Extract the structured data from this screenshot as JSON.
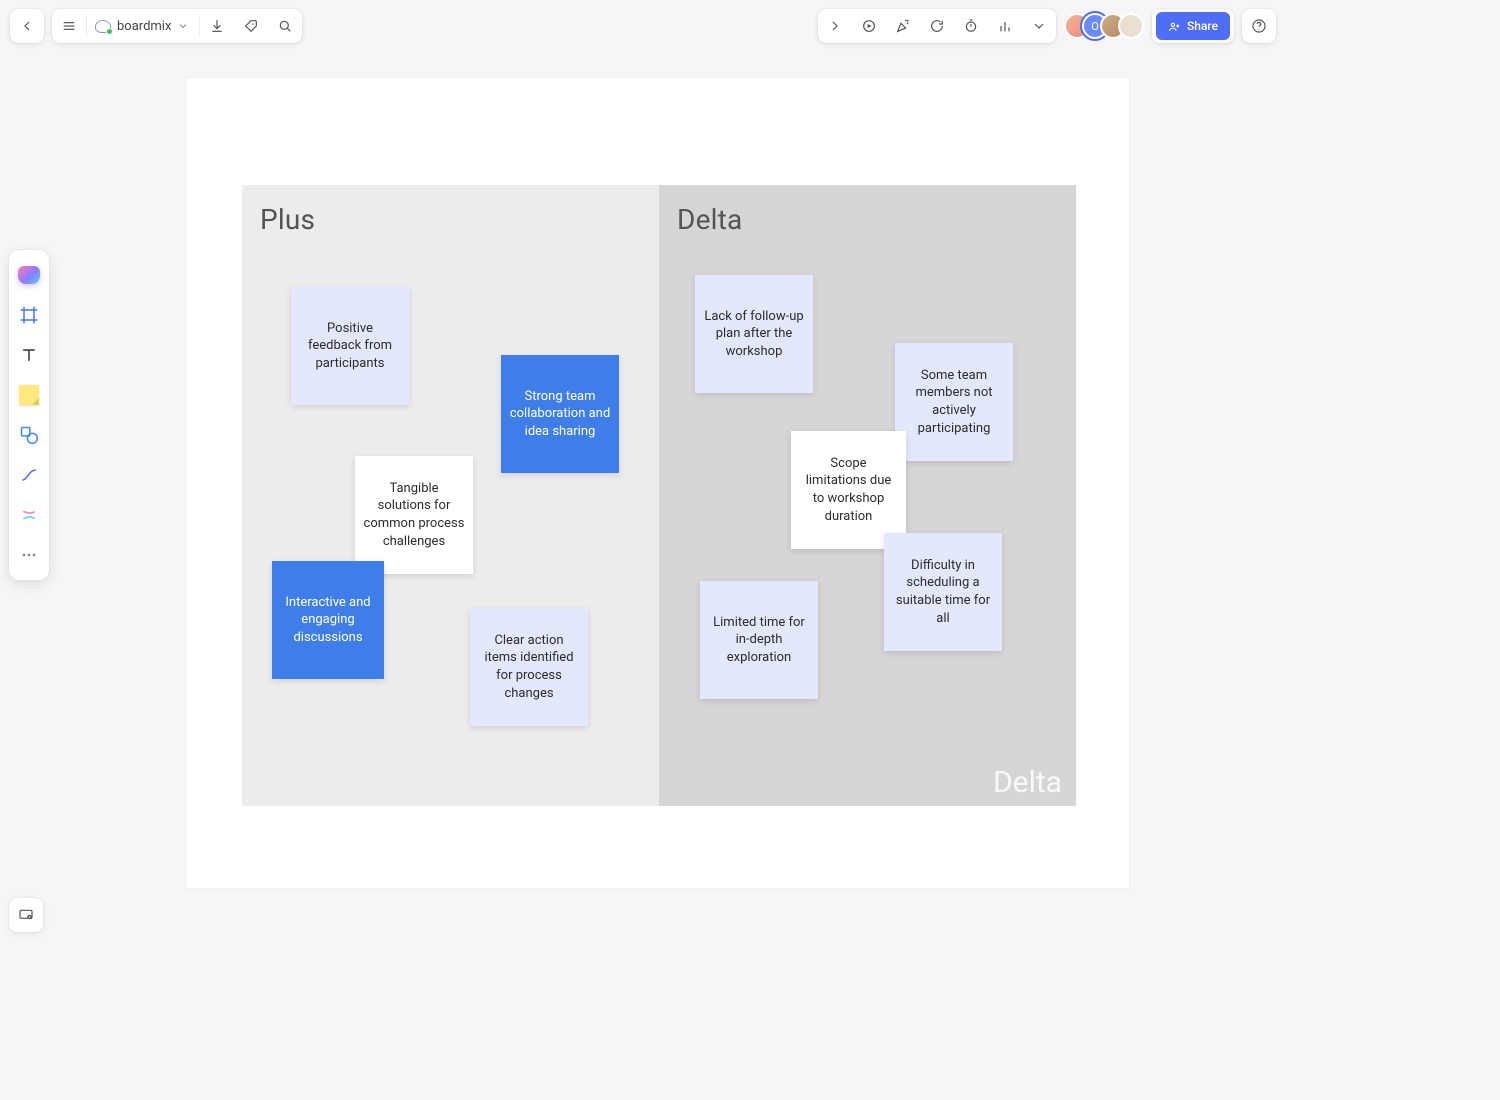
{
  "app": {
    "title": "boardmix",
    "share_label": "Share"
  },
  "board": {
    "columns": {
      "plus": {
        "title": "Plus"
      },
      "delta": {
        "title": "Delta",
        "watermark": "Delta"
      }
    },
    "plus_notes": [
      {
        "text": "Positive feedback from participants"
      },
      {
        "text": "Strong team collaboration and idea sharing"
      },
      {
        "text": "Tangible solutions for common process challenges"
      },
      {
        "text": "Interactive and engaging discussions"
      },
      {
        "text": "Clear action items identified for process changes"
      }
    ],
    "delta_notes": [
      {
        "text": "Lack of follow-up plan after the workshop"
      },
      {
        "text": "Some team members not actively participating"
      },
      {
        "text": "Scope limitations due to workshop duration"
      },
      {
        "text": "Limited time for in-depth exploration"
      },
      {
        "text": "Difficulty in scheduling a suitable time for all"
      }
    ]
  },
  "avatars": [
    {
      "initial": "",
      "bg": "linear-gradient(135deg,#f7b49b,#e78b7a)"
    },
    {
      "initial": "O",
      "bg": "#6a8bff"
    },
    {
      "initial": "",
      "bg": "linear-gradient(135deg,#d1b08a,#b08860)"
    },
    {
      "initial": "",
      "bg": "#eadfd3"
    }
  ],
  "colors": {
    "accent": "#4f6df5",
    "note_blue": "#3f7ee8",
    "note_lavender": "#e3e8ff"
  }
}
